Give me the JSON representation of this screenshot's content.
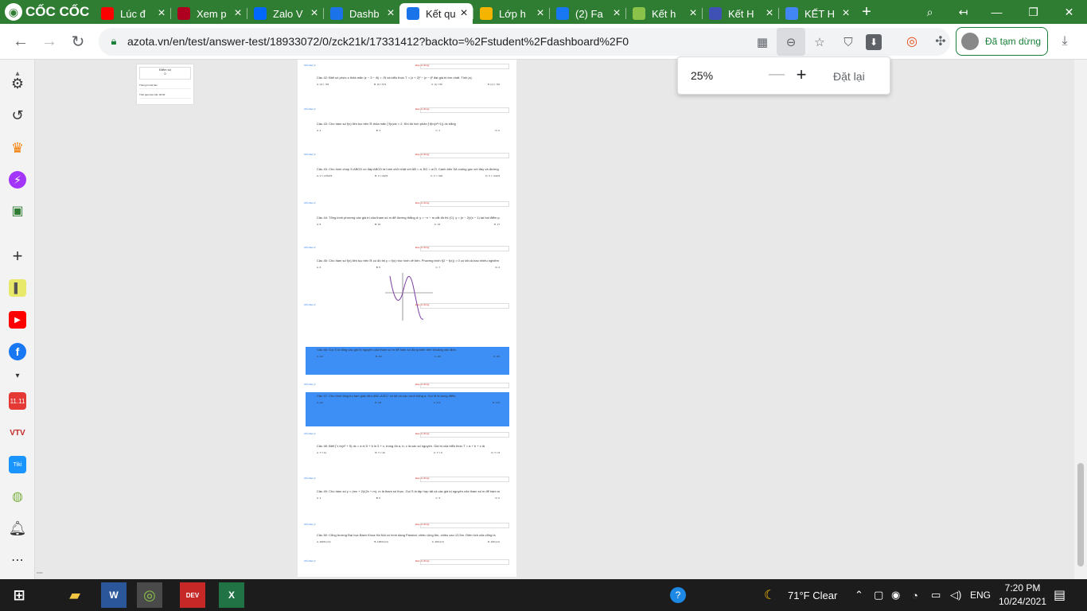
{
  "browser": {
    "brand": "CỐC CỐC",
    "tabs": [
      {
        "title": "Lúc đ",
        "fav": "youtube-icon",
        "color": "#ff0000"
      },
      {
        "title": "Xem p",
        "fav": "red-circle-icon",
        "color": "#b00020"
      },
      {
        "title": "Zalo V",
        "fav": "zalo-icon",
        "color": "#0068ff"
      },
      {
        "title": "Dashb",
        "fav": "azota-icon",
        "color": "#1a73e8"
      },
      {
        "title": "Kết qu",
        "fav": "azota-icon",
        "color": "#1a73e8",
        "active": true
      },
      {
        "title": "Lớp h",
        "fav": "classroom-icon",
        "color": "#f4b400"
      },
      {
        "title": "(2) Fa",
        "fav": "facebook-icon",
        "color": "#1877f2"
      },
      {
        "title": "Kết h",
        "fav": "coccoc-icon",
        "color": "#8bc34a"
      },
      {
        "title": "Kết H",
        "fav": "kethi-icon",
        "color": "#3f51b5"
      },
      {
        "title": "KẾT H",
        "fav": "google-icon",
        "color": "#4285f4"
      }
    ],
    "url": "azota.vn/en/test/answer-test/18933072/0/zck21k/17331412?backto=%2Fstudent%2Fdashboard%2F0",
    "profile_label": "Đã tạm dừng"
  },
  "zoom_popup": {
    "value": "25%",
    "minus": "—",
    "plus": "+",
    "reset": "Đặt lại"
  },
  "page": {
    "score_label": "Điểm số",
    "score_value": "0",
    "rows": [
      "Thông tin bài làm",
      "Thời gian làm bài: 00:00"
    ],
    "answer_label": "Chỉ chọn ∨",
    "correct_label": "Đáp án đúng:",
    "questions": [
      {
        "title": "Câu 42: Biết số phức z thỏa mãn |z − 3 − 4i| = √5 và biểu thức T = |z + 2|² − |z − i|² đạt giá trị lớn nhất. Tính |z|.",
        "opts": [
          "A. |z| = √33",
          "B. |z| = 5√2",
          "C. |z| = 50",
          "D. |z| = √10"
        ],
        "key": "B"
      },
      {
        "title": "Câu 43: Cho hàm số f(x) liên tục trên ℝ thỏa mãn ∫ f(x)dx = 2. Khi đó tích phân ∫ f(ln(x²+1)) dx bằng",
        "opts": [
          "A. 4",
          "B. 3",
          "C. 1",
          "D. 2"
        ],
        "key": "C"
      },
      {
        "title": "Câu 43: Cho hình chóp S.ABCD có đáy ABCD là hình chữ nhật với AB = a, BC = a√3. Cạnh bên SA vuông góc với đáy và đường thẳng SC tạo với mặt phẳng (SAB) một góc 30°. Tính thể tích V của khối chóp S.ABCD theo a.",
        "opts": [
          "A. V = 2√6a³/3",
          "B. V = 2a³/3",
          "C. V = √2a³",
          "D. V = √2a³/3"
        ],
        "key": "A"
      },
      {
        "title": "Câu 44: Tổng bình phương các giá trị của tham số m để đường thẳng d: y = −x − m cắt đồ thị (C): y = (x − 2)/(x − 1) tại hai điểm phân biệt A, B với AB = 2√2 là",
        "opts": [
          "A. 5",
          "B. 10",
          "C. 13",
          "D. 17"
        ],
        "key": "B"
      },
      {
        "title": "Câu 45: Cho hàm số f(x) liên tục trên ℝ có đồ thị y = f(x) như hình vẽ bên. Phương trình f(2 − f(x)) = 0 có tất cả bao nhiêu nghiệm phân biệt.",
        "opts": [
          "A. 6",
          "B. 5",
          "C. 7",
          "D. 4"
        ],
        "key": "B"
      },
      {
        "title": "Câu 46: Gọi S là tổng các giá trị nguyên của tham số m để hàm số đồng biến trên khoảng xác định.",
        "opts": [
          "A. 1/2",
          "B. 1/3",
          "C. 2/3",
          "D. 3/4"
        ],
        "key": "A"
      },
      {
        "title": "Câu 47: Cho hình lăng trụ tam giác đều ABC.A'B'C' có tất cả các cạnh bằng a. Gọi M là trung điểm.",
        "opts": [
          "A. a/2",
          "B. a/3",
          "C. a√2",
          "D. a√3"
        ],
        "key": "B"
      },
      {
        "title": "Câu 48: Biết ∫ x ln(x² + 9) dx = a ln 5 + b ln 3 + c, trong đó a, b, c là các số nguyên. Giá trị của biểu thức T = a + b + c là",
        "opts": [
          "A. T = 11",
          "B. T = 10",
          "C. T = 9",
          "D. T = 8"
        ],
        "key": "D"
      },
      {
        "title": "Câu 49: Cho hàm số y = (mx + 2)/(2x + m), m là tham số thực. Gọi S là tập hợp tất cả các giá trị nguyên của tham số m để hàm số nghịch biến trên khoảng (0;1). Tìm số phần tử của S.",
        "opts": [
          "A. 1",
          "B. 5",
          "C. 3",
          "D. 2"
        ],
        "key": "D"
      },
      {
        "title": "Câu 50: Cổng trường Đại học Bách Khoa Hà Nội có hình dạng Parabol, chiều rộng 8m, chiều cao 12,5m. Diện tích của cổng là",
        "opts": [
          "A. 200/3 (m²)",
          "B. 100/3 (m²)",
          "C. 200 (m²)",
          "D. 100 (m²)"
        ],
        "key": "A"
      }
    ]
  },
  "taskbar": {
    "weather": "71°F  Clear",
    "lang": "ENG",
    "time": "7:20 PM",
    "date": "10/24/2021",
    "apps": [
      "file-explorer-icon",
      "word-icon",
      "coccoc-icon",
      "devcpp-icon",
      "excel-icon"
    ]
  }
}
